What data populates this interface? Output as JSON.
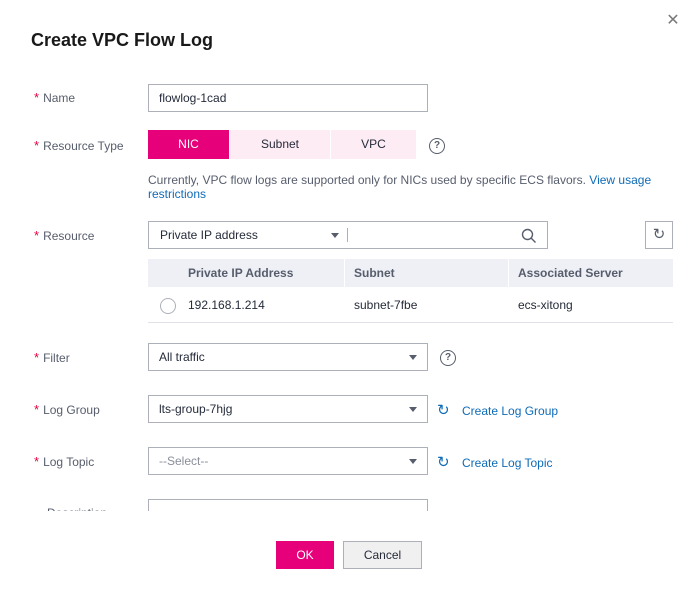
{
  "dialog": {
    "title": "Create VPC Flow Log",
    "close_symbol": "✕"
  },
  "required_mark": "*",
  "name_field": {
    "label": "Name",
    "value": "flowlog-1cad"
  },
  "resource_type": {
    "label": "Resource Type",
    "options": [
      "NIC",
      "Subnet",
      "VPC"
    ],
    "selected": "NIC",
    "help_symbol": "?",
    "hint_text": "Currently, VPC flow logs are supported only for NICs used by specific ECS flavors.",
    "hint_link": "View usage restrictions"
  },
  "resource": {
    "label": "Resource",
    "search_type": "Private IP address",
    "search_value": "",
    "refresh_symbol": "↻",
    "table": {
      "columns": [
        "Private IP Address",
        "Subnet",
        "Associated Server"
      ],
      "rows": [
        {
          "ip": "192.168.1.214",
          "subnet": "subnet-7fbe",
          "server": "ecs-xitong"
        }
      ]
    }
  },
  "filter_field": {
    "label": "Filter",
    "value": "All traffic",
    "help_symbol": "?"
  },
  "log_group": {
    "label": "Log Group",
    "value": "lts-group-7hjg",
    "refresh_symbol": "↻",
    "create_link": "Create Log Group"
  },
  "log_topic": {
    "label": "Log Topic",
    "value": "--Select--",
    "refresh_symbol": "↻",
    "create_link": "Create Log Topic"
  },
  "description": {
    "label": "Description",
    "value": ""
  },
  "footer": {
    "ok_label": "OK",
    "cancel_label": "Cancel"
  },
  "colors": {
    "accent": "#e6007a",
    "link": "#0f6bb7",
    "required": "#e6003e"
  },
  "icons": {
    "close": "close-icon",
    "help": "help-icon",
    "search": "search-icon",
    "refresh": "refresh-icon",
    "dropdown": "chevron-down-icon"
  }
}
